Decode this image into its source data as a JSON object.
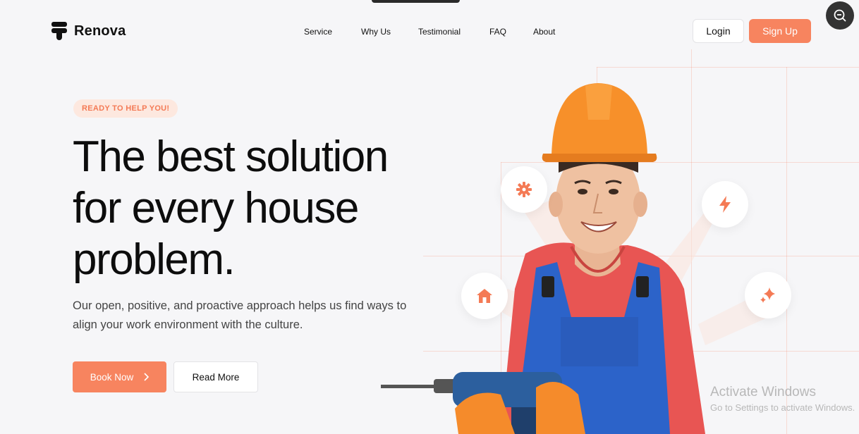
{
  "brand": {
    "name": "Renova",
    "accent": "#f7845f"
  },
  "nav": {
    "items": [
      {
        "label": "Service"
      },
      {
        "label": "Why Us"
      },
      {
        "label": "Testimonial"
      },
      {
        "label": "FAQ"
      },
      {
        "label": "About"
      }
    ]
  },
  "header": {
    "login_label": "Login",
    "signup_label": "Sign Up"
  },
  "hero": {
    "badge": "READY TO HELP YOU!",
    "headline_line1": "The best solution",
    "headline_line2": "for every house",
    "headline_line3": "problem.",
    "subtext": "Our open, positive, and proactive approach helps us find ways to align your work environment with the culture.",
    "book_label": "Book Now",
    "read_label": "Read More"
  },
  "features": [
    {
      "icon": "gear-icon"
    },
    {
      "icon": "lightning-icon"
    },
    {
      "icon": "home-icon"
    },
    {
      "icon": "sparkle-icon"
    }
  ],
  "watermark": {
    "line1": "Activate Windows",
    "line2": "Go to Settings to activate Windows."
  }
}
